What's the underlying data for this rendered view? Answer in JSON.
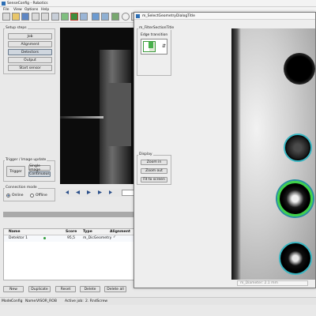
{
  "app": {
    "title": "SenseConfig - Robotics",
    "menu": [
      "File",
      "View",
      "Options",
      "Help"
    ]
  },
  "setup": {
    "title": "Setup steps",
    "buttons": [
      "Job",
      "Alignment",
      "Detectors",
      "Output",
      "Start sensor"
    ]
  },
  "trigger": {
    "title": "Trigger / Image update",
    "trigger_label": "Trigger",
    "single_label": "Single image",
    "continuous_label": "Continuous"
  },
  "connection": {
    "title": "Connection mode",
    "online": "Online",
    "offline": "Offline",
    "selected": "Online"
  },
  "table": {
    "headers": [
      "Name",
      "Score",
      "Type",
      "Alignment"
    ],
    "rows": [
      {
        "name": "Detektor 1",
        "score": "95,5",
        "type": "m_DicGeometry",
        "alignment": "✓"
      }
    ]
  },
  "bottom_buttons": [
    "New",
    "Duplicate",
    "Reset",
    "Delete",
    "Delete all"
  ],
  "status": {
    "mode_label": "Mode:",
    "mode_value": "Config",
    "name_label": "Name:",
    "name_value": "VISOR_ROB",
    "job_label": "Active job:",
    "job_value": "2. RndScrew"
  },
  "dialog": {
    "title": "m_SelectGeometryDialogTitle",
    "filter_section": "m_FilterSectionTitle",
    "edge_label": "Edge transition",
    "display_title": "Display",
    "zoom_in": "Zoom in",
    "zoom_out": "Zoom out",
    "fit": "Fit to screen",
    "readout": "m_Diameter: 2.1 mm"
  }
}
